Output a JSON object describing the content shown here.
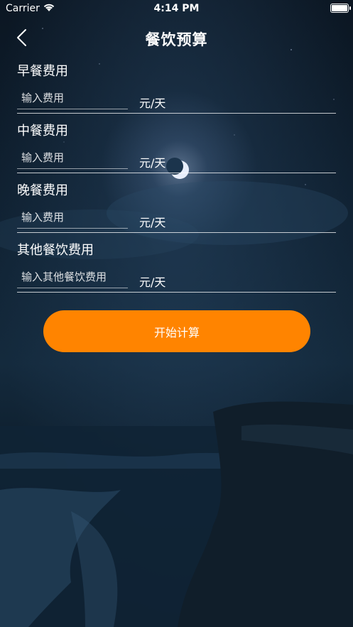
{
  "status_bar": {
    "carrier": "Carrier",
    "time": "4:14 PM",
    "wifi_icon": "wifi-icon",
    "battery_icon": "battery-icon"
  },
  "nav": {
    "title": "餐饮预算",
    "back_icon": "chevron-left-icon"
  },
  "fields": [
    {
      "label": "早餐费用",
      "placeholder": "输入费用",
      "unit": "元/天"
    },
    {
      "label": "中餐费用",
      "placeholder": "输入费用",
      "unit": "元/天"
    },
    {
      "label": "晚餐费用",
      "placeholder": "输入费用",
      "unit": "元/天"
    },
    {
      "label": "其他餐饮费用",
      "placeholder": "输入其他餐饮费用",
      "unit": "元/天"
    }
  ],
  "calc_button": {
    "label": "开始计算",
    "color": "#ff8400"
  },
  "background": {
    "theme": "night-sea-moon"
  }
}
